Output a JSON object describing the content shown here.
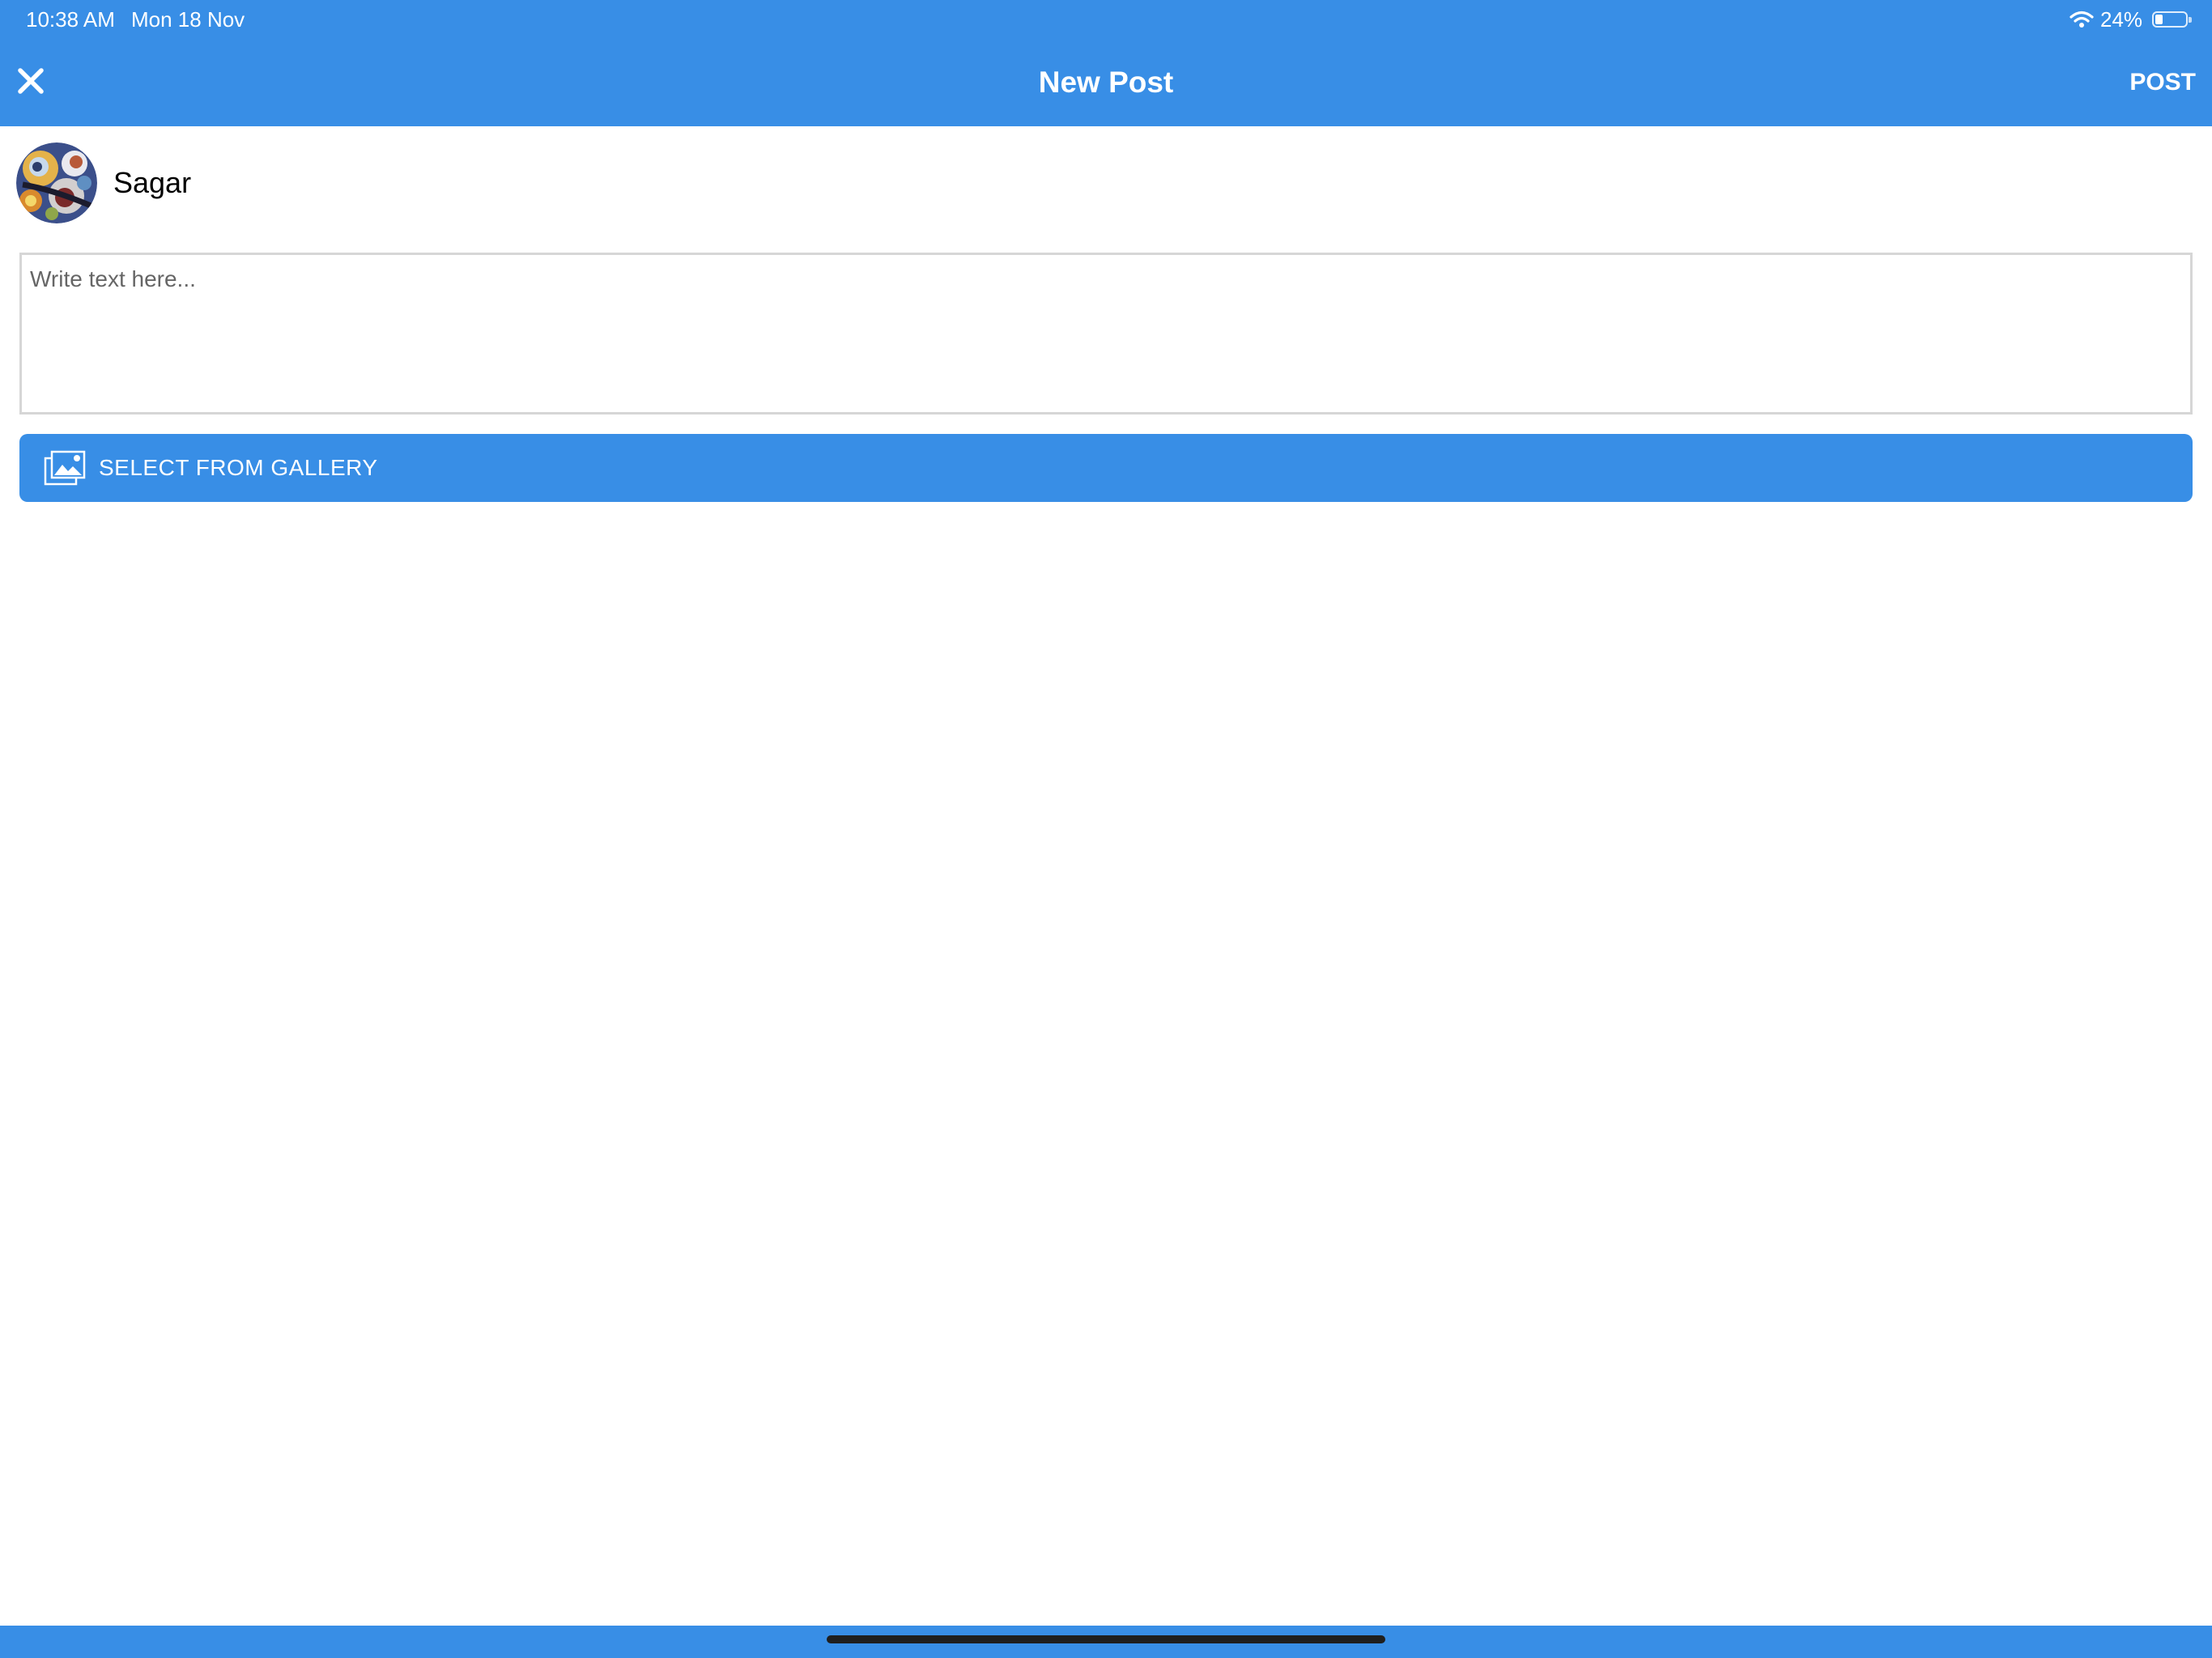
{
  "status_bar": {
    "time": "10:38 AM",
    "date": "Mon 18 Nov",
    "battery_percent": "24%",
    "battery_level": 0.24,
    "icons": [
      "wifi-icon",
      "battery-icon"
    ]
  },
  "nav_bar": {
    "title": "New Post",
    "close_icon": "close-icon",
    "post_label": "POST"
  },
  "user": {
    "name": "Sagar",
    "avatar_icon": "avatar"
  },
  "composer": {
    "placeholder": "Write text here...",
    "value": ""
  },
  "gallery_button": {
    "label": "SELECT FROM GALLERY",
    "icon": "gallery-icon"
  },
  "colors": {
    "accent": "#388ee6",
    "background": "#ffffff",
    "text": "#000000",
    "input_border": "#d6d6d6"
  }
}
